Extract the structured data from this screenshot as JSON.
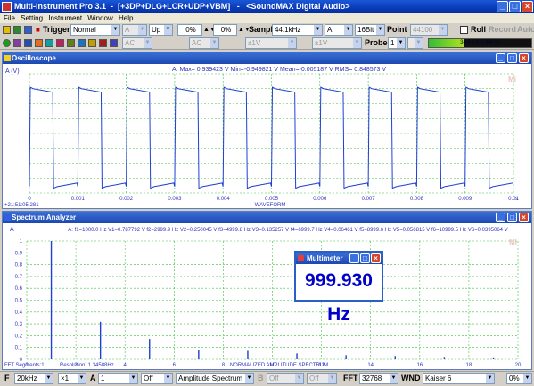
{
  "window": {
    "title": "Multi-Instrument Pro 3.1  -  [+3DP+DLG+LCR+UDP+VBM]   -   <SoundMAX Digital Audio>",
    "minimize": "_",
    "maximize": "□",
    "close": "×"
  },
  "menu": [
    "File",
    "Setting",
    "Instrument",
    "Window",
    "Help"
  ],
  "toolbar1": {
    "trigger_label": "Trigger",
    "trigger_mode": "Normal",
    "trigger_channel": "A",
    "trigger_edge": "Up",
    "trigger_pct1": "0%",
    "trigger_pct2": "0%",
    "sample_label": "Sample",
    "sample_rate": "44.1kHz",
    "channel": "A",
    "bits": "16Bit",
    "point_label": "Point",
    "points": "44100",
    "roll_label": "Roll",
    "record_label": "Record",
    "auto_label": "Auto"
  },
  "toolbar2": {
    "ac1": "AC",
    "ac2": "AC",
    "v1": "±1V",
    "v2": "±1V",
    "probe_label": "Probe",
    "probe_value": "1",
    "level_text": "34% (-9.5 dBFS)"
  },
  "oscilloscope": {
    "title": "Oscilloscope",
    "yunit": "A (V)",
    "stats": "A: Max= 0.939423 V   Min=-0.949821 V   Mean=-0.005187 V   RMS= 0.848573 V",
    "watermark": "Mi",
    "xticks": [
      "0",
      "0.001",
      "0.002",
      "0.003",
      "0.004",
      "0.005",
      "0.006",
      "0.007",
      "0.008",
      "0.009",
      "0.01"
    ],
    "xunit": "s",
    "xlabel": "WAVEFORM",
    "timestamp": "+21:51:05:281"
  },
  "spectrum": {
    "title": "Spectrum Analyzer",
    "ylabel": "A",
    "stats": "A: f1=1000.0 Hz  V1=0.787792 V  f2=2999.9 Hz  V2=0.250045 V  f3=4999.8 Hz  V3=0.135257 V  f4=6999.7 Hz  V4=0.06461 V  f5=8999.6 Hz  V5=0.056815 V  f6=10999.5 Hz  V6=0.0395064 V",
    "watermark": "Mi",
    "yticks": [
      "1",
      "0.9",
      "0.8",
      "0.7",
      "0.6",
      "0.5",
      "0.4",
      "0.3",
      "0.2",
      "0.1",
      "0"
    ],
    "xticks": [
      "0",
      "2",
      "4",
      "6",
      "8",
      "10",
      "12",
      "14",
      "16",
      "18",
      "20"
    ],
    "xunit": "kHz",
    "xlabel": "NORMALIZED AMPLITUDE SPECTRUM",
    "segments": "FFT Segments:1",
    "resolution": "Resolution: 1.34588Hz"
  },
  "multimeter": {
    "title": "Multimeter",
    "value": "999.930 Hz"
  },
  "bottom": {
    "f_label": "F",
    "freq_range": "20kHz",
    "zoom": "×1",
    "a_label": "A",
    "a_value": "1",
    "off1": "Off",
    "function": "Amplitude Spectrum",
    "b_label": "B",
    "off2": "Off",
    "off3": "Off",
    "fft_label": "FFT",
    "fft_size": "32768",
    "wnd_label": "WND",
    "window_fn": "Kaiser 6",
    "overlap": "0%"
  },
  "chart_data": [
    {
      "type": "line",
      "title": "WAVEFORM",
      "xlabel": "s",
      "ylabel": "A (V)",
      "xlim": [
        0,
        0.01
      ],
      "ylim": [
        -1,
        1
      ],
      "series": [
        {
          "name": "A",
          "x_period": 0.001,
          "high": 0.939423,
          "low": -0.949821
        }
      ]
    },
    {
      "type": "bar",
      "title": "NORMALIZED AMPLITUDE SPECTRUM",
      "xlabel": "kHz",
      "ylabel": "A",
      "xlim": [
        0,
        20
      ],
      "ylim": [
        0,
        1
      ],
      "x": [
        1,
        3,
        5,
        7,
        9,
        11,
        13,
        15,
        17,
        19
      ],
      "values": [
        1.0,
        0.317,
        0.172,
        0.082,
        0.072,
        0.05,
        0.035,
        0.028,
        0.02,
        0.016
      ]
    }
  ]
}
